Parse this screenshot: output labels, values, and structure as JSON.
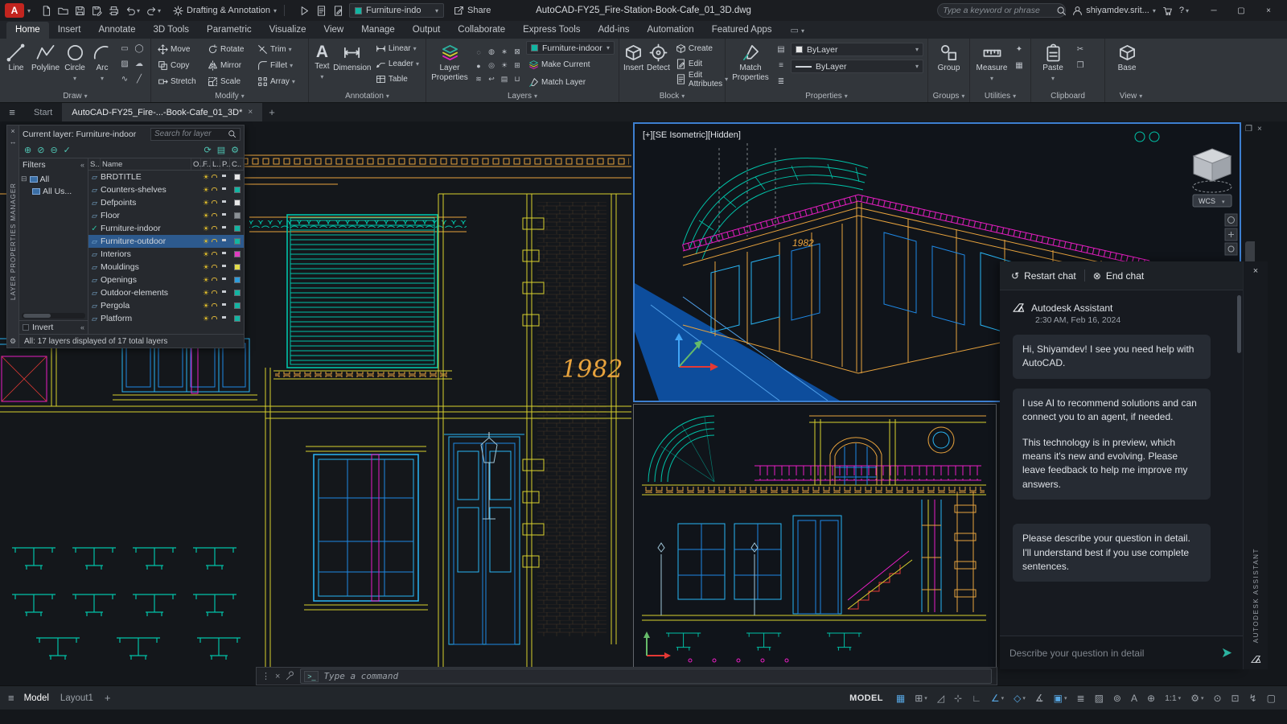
{
  "icon_glyphs": {
    "minimize": "─",
    "maximize": "▢",
    "close": "×",
    "help": "?",
    "hamburger": "≡",
    "collapse": "«",
    "restart": "↺",
    "end": "⊗",
    "command_prompt": ">_",
    "grip": "⋮",
    "expand_tree": "⊟"
  },
  "titlebar": {
    "logo": "A",
    "qat_icons": [
      {
        "name": "new-file-icon",
        "sym": "#s-file"
      },
      {
        "name": "open-folder-icon",
        "sym": "#s-folder"
      },
      {
        "name": "save-icon",
        "sym": "#s-floppy"
      },
      {
        "name": "save-as-icon",
        "sym": "#s-floppy-pen"
      },
      {
        "name": "plot-icon",
        "sym": "#s-printer"
      },
      {
        "name": "undo-icon",
        "sym": "#s-undo",
        "dd": true
      },
      {
        "name": "redo-icon",
        "sym": "#s-redo",
        "dd": true
      }
    ],
    "workspace": "Drafting & Annotation",
    "extra_icons": [
      {
        "name": "play-icon",
        "sym": "#s-play"
      },
      {
        "name": "markup-import-icon",
        "sym": "#s-doc-mark"
      },
      {
        "name": "markup-assist-icon",
        "sym": "#s-doc-pen"
      }
    ],
    "qat_layer_combo": "Furniture-indo",
    "share_label": "Share",
    "title": "AutoCAD-FY25_Fire-Station-Book-Cafe_01_3D.dwg",
    "search_placeholder": "Type a keyword or phrase",
    "user_name": "shiyamdev.srit..."
  },
  "ribbon": {
    "tabs": [
      {
        "label": "Home",
        "cls": "active"
      },
      {
        "label": "Insert"
      },
      {
        "label": "Annotate"
      },
      {
        "label": "3D Tools"
      },
      {
        "label": "Parametric"
      },
      {
        "label": "Visualize"
      },
      {
        "label": "View"
      },
      {
        "label": "Manage"
      },
      {
        "label": "Output"
      },
      {
        "label": "Collaborate"
      },
      {
        "label": "Express Tools"
      },
      {
        "label": "Add-ins"
      },
      {
        "label": "Automation"
      },
      {
        "label": "Featured Apps"
      }
    ],
    "draw": {
      "label": "Draw",
      "line": "Line",
      "polyline": "Polyline",
      "circle": "Circle",
      "arc": "Arc",
      "mini_icons": [
        {
          "name": "rectangle-icon",
          "glyph": "▭"
        },
        {
          "name": "ellipse-icon",
          "glyph": "◯"
        },
        {
          "name": "hatch-icon",
          "glyph": "▨"
        },
        {
          "name": "revision-cloud-icon",
          "glyph": "☁"
        },
        {
          "name": "spline-icon",
          "glyph": "∿"
        },
        {
          "name": "construction-line-icon",
          "glyph": "╱"
        }
      ]
    },
    "modify": {
      "label": "Modify",
      "tools": [
        {
          "label": "Move",
          "sym": "#s-move"
        },
        {
          "label": "Rotate",
          "sym": "#s-rotate"
        },
        {
          "label": "Trim",
          "sym": "#s-trim",
          "dd": true
        },
        {
          "label": "Copy",
          "sym": "#s-copy"
        },
        {
          "label": "Mirror",
          "sym": "#s-mirror"
        },
        {
          "label": "Fillet",
          "sym": "#s-fillet",
          "dd": true
        },
        {
          "label": "Stretch",
          "sym": "#s-stretch"
        },
        {
          "label": "Scale",
          "sym": "#s-scale"
        },
        {
          "label": "Array",
          "sym": "#s-array",
          "dd": true
        }
      ]
    },
    "annotation": {
      "label": "Annotation",
      "text": "Text",
      "dimension": "Dimension",
      "small": [
        {
          "label": "Linear",
          "sym": "#s-dim",
          "dd": true
        },
        {
          "label": "Leader",
          "sym": "#s-leader",
          "dd": true
        },
        {
          "label": "Table",
          "sym": "#s-table"
        }
      ]
    },
    "layers": {
      "label": "Layers",
      "layer_properties": "Layer Properties",
      "combo_value": "Furniture-indoor",
      "make_current": "Make Current",
      "match_layer": "Match Layer",
      "mini_icons": [
        {
          "name": "layer-off-icon",
          "glyph": "◌"
        },
        {
          "name": "layer-isolate-icon",
          "glyph": "◍"
        },
        {
          "name": "layer-freeze-icon",
          "glyph": "∗"
        },
        {
          "name": "layer-lock-icon",
          "glyph": "⊠"
        },
        {
          "name": "layer-on-icon",
          "glyph": "●"
        },
        {
          "name": "layer-unisolate-icon",
          "glyph": "◎"
        },
        {
          "name": "layer-thaw-icon",
          "glyph": "☀"
        },
        {
          "name": "layer-unlock-icon",
          "glyph": "⊞"
        },
        {
          "name": "layer-walk-icon",
          "glyph": "≋"
        },
        {
          "name": "layer-previous-icon",
          "glyph": "↩"
        },
        {
          "name": "layer-states-icon",
          "glyph": "▤"
        },
        {
          "name": "layer-merge-icon",
          "glyph": "⊔"
        }
      ]
    },
    "block": {
      "label": "Block",
      "insert": "Insert",
      "detect": "Detect",
      "create": "Create",
      "edit": "Edit",
      "edit_attributes": "Edit Attributes"
    },
    "properties": {
      "label": "Properties",
      "match_properties": "Match Properties",
      "color_value": "ByLayer",
      "lineweight_value": "ByLayer",
      "mini_icons": [
        {
          "name": "object-color-icon",
          "glyph": "▤"
        },
        {
          "name": "linetype-icon",
          "glyph": "≡"
        },
        {
          "name": "lineweight-list-icon",
          "glyph": "≣"
        }
      ]
    },
    "groups": {
      "label": "Groups",
      "group": "Group"
    },
    "utilities": {
      "label": "Utilities",
      "measure": "Measure",
      "mini_icons": [
        {
          "name": "quick-select-icon",
          "glyph": "✦"
        },
        {
          "name": "quick-calculator-icon",
          "glyph": "▦"
        }
      ]
    },
    "clipboard": {
      "label": "Clipboard",
      "paste": "Paste",
      "mini_icons": [
        {
          "name": "cut-icon",
          "glyph": "✂"
        },
        {
          "name": "copy-clip-icon",
          "glyph": "❐"
        }
      ]
    },
    "view_panel": {
      "label": "View",
      "base": "Base"
    }
  },
  "filetabs": {
    "start": "Start",
    "active_doc": "AutoCAD-FY25_Fire-...-Book-Cafe_01_3D*"
  },
  "palette": {
    "vertical_title": "LAYER PROPERTIES MANAGER",
    "current_layer": "Current layer: Furniture-indoor",
    "search_placeholder": "Search for layer",
    "toolbar_icons": [
      {
        "name": "new-layer-icon",
        "glyph": "⊕"
      },
      {
        "name": "new-frozen-layer-icon",
        "glyph": "⊘"
      },
      {
        "name": "delete-layer-icon",
        "glyph": "⊖"
      },
      {
        "name": "set-current-layer-icon",
        "glyph": "✓"
      }
    ],
    "toolbar_right_icons": [
      {
        "name": "refresh-icon",
        "glyph": "⟳"
      },
      {
        "name": "layer-states-manager-icon",
        "glyph": "▤"
      },
      {
        "name": "settings-icon",
        "glyph": "⚙"
      }
    ],
    "filters_label": "Filters",
    "tree_all": "All",
    "tree_all_used": "All Us...",
    "columns": [
      "S..",
      "Name",
      "O..",
      "F..",
      "L..",
      "P..",
      "C.."
    ],
    "layers": [
      {
        "name": "BRDTITLE",
        "color": "#e8e8e8",
        "status": "▱",
        "stc": "",
        "cls": ""
      },
      {
        "name": "Counters-shelves",
        "color": "#12b5a2",
        "status": "▱",
        "stc": "",
        "cls": ""
      },
      {
        "name": "Defpoints",
        "color": "#e8e8e8",
        "status": "▱",
        "stc": "",
        "cls": ""
      },
      {
        "name": "Floor",
        "color": "#8b9196",
        "status": "▱",
        "stc": "",
        "cls": ""
      },
      {
        "name": "Furniture-indoor",
        "color": "#12b5a2",
        "status": "✓",
        "stc": "cur",
        "cls": "current-row"
      },
      {
        "name": "Furniture-outdoor",
        "color": "#12b5a2",
        "status": "▱",
        "stc": "",
        "cls": "selected-row"
      },
      {
        "name": "Interiors",
        "color": "#df3bc0",
        "status": "▱",
        "stc": "",
        "cls": ""
      },
      {
        "name": "Mouldings",
        "color": "#e3dc4a",
        "status": "▱",
        "stc": "",
        "cls": ""
      },
      {
        "name": "Openings",
        "color": "#2d9cdb",
        "status": "▱",
        "stc": "",
        "cls": ""
      },
      {
        "name": "Outdoor-elements",
        "color": "#12b5a2",
        "status": "▱",
        "stc": "",
        "cls": ""
      },
      {
        "name": "Pergola",
        "color": "#12b5a2",
        "status": "▱",
        "stc": "",
        "cls": ""
      },
      {
        "name": "Platform",
        "color": "#12b5a2",
        "status": "▱",
        "stc": "",
        "cls": ""
      }
    ],
    "invert_label": "Invert",
    "status_text": "All: 17 layers displayed of 17 total layers"
  },
  "canvas": {
    "year_sign": "1982"
  },
  "viewport": {
    "label": "[+][SE Isometric][Hidden]",
    "wcs": "WCS"
  },
  "assistant": {
    "restart_label": "Restart chat",
    "end_label": "End chat",
    "sender": "Autodesk Assistant",
    "timestamp": "2:30 AM, Feb 16, 2024",
    "msg1": "Hi, Shiyamdev! I see you need help with AutoCAD.",
    "msg2a": "I use AI to recommend solutions and can connect you to an agent, if needed.",
    "msg2b": "This technology is in preview, which means it's new and evolving. Please leave feedback to help me improve my answers.",
    "msg3": "Please describe your question in detail. I'll understand best if you use complete sentences.",
    "input_placeholder": "Describe your question in detail",
    "vertical_label": "AUTODESK ASSISTANT"
  },
  "commandline": {
    "prompt_placeholder": "Type a command"
  },
  "statusbar": {
    "model_tab": "Model",
    "layout_tab": "Layout1",
    "new_layout": "+",
    "model_label": "MODEL",
    "icons": [
      {
        "name": "grid-icon",
        "glyph": "▦",
        "cls": "on"
      },
      {
        "name": "snap-mode-icon",
        "glyph": "⊞",
        "dd": true
      },
      {
        "name": "infer-constraints-icon",
        "glyph": "◿"
      },
      {
        "name": "dynamic-input-icon",
        "glyph": "⊹"
      },
      {
        "name": "ortho-mode-icon",
        "glyph": "∟"
      },
      {
        "name": "polar-tracking-icon",
        "glyph": "∠",
        "dd": true,
        "cls": "on"
      },
      {
        "name": "isometric-drafting-icon",
        "glyph": "◇",
        "dd": true,
        "cls": "on"
      },
      {
        "name": "object-snap-tracking-icon",
        "glyph": "∡"
      },
      {
        "name": "object-snap-icon",
        "glyph": "▣",
        "dd": true,
        "cls": "on"
      },
      {
        "name": "lineweight-icon",
        "glyph": "≣"
      },
      {
        "name": "transparency-icon",
        "glyph": "▨"
      },
      {
        "name": "selection-cycling-icon",
        "glyph": "⊚"
      },
      {
        "name": "annotation-visibility-icon",
        "glyph": "A"
      },
      {
        "name": "autoscale-icon",
        "glyph": "⊕"
      },
      {
        "name": "annotation-scale-icon",
        "glyph": "1:1",
        "dd": true,
        "cls": "txt"
      },
      {
        "name": "workspace-switching-icon",
        "glyph": "⚙",
        "dd": true
      },
      {
        "name": "annotation-monitor-icon",
        "glyph": "⊙"
      },
      {
        "name": "units-icon",
        "glyph": "⊡"
      },
      {
        "name": "graphics-performance-icon",
        "glyph": "↯"
      },
      {
        "name": "clean-screen-icon",
        "glyph": "▢"
      }
    ]
  }
}
